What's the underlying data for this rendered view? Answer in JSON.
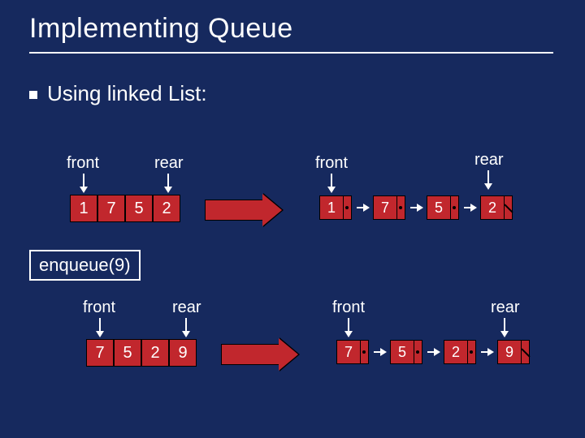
{
  "title": "Implementing Queue",
  "subtitle": "Using linked List:",
  "operation": "enqueue(9)",
  "labels": {
    "front": "front",
    "rear": "rear"
  },
  "row1": {
    "array": [
      "1",
      "7",
      "5",
      "2"
    ],
    "linked": [
      "1",
      "7",
      "5",
      "2"
    ]
  },
  "row2": {
    "array": [
      "7",
      "5",
      "2",
      "9"
    ],
    "linked": [
      "7",
      "5",
      "2",
      "9"
    ]
  }
}
